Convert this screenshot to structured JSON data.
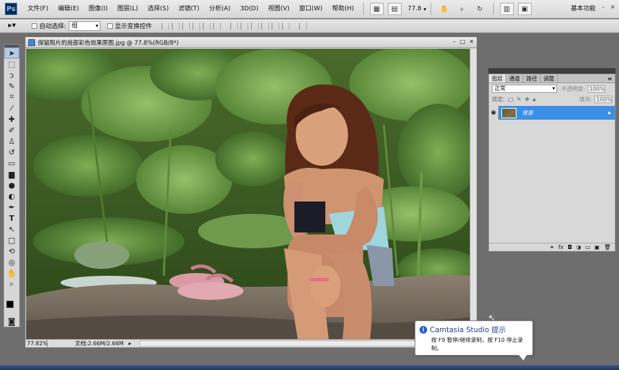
{
  "app": {
    "logo": "Ps"
  },
  "menu": [
    "文件(F)",
    "编辑(E)",
    "图像(I)",
    "图层(L)",
    "选择(S)",
    "滤镜(T)",
    "分析(A)",
    "3D(D)",
    "视图(V)",
    "窗口(W)",
    "帮助(H)"
  ],
  "menubar": {
    "zoom": "77.8",
    "workspace": "基本功能"
  },
  "options": {
    "auto_select_label": "自动选择:",
    "auto_select_value": "组",
    "show_transform_label": "显示变换控件"
  },
  "document": {
    "title": "保留照片的局部彩色效果原图.jpg @ 77.8%(RGB/8*)",
    "zoom": "77.82%",
    "doc_info": "文档:2.66M/2.66M"
  },
  "layers_panel": {
    "tabs": [
      "图层",
      "通道",
      "路径",
      "调整"
    ],
    "blend_mode": "正常",
    "opacity_label": "不透明度:",
    "opacity_value": "100%",
    "lock_label": "锁定:",
    "fill_label": "填充:",
    "fill_value": "100%",
    "layer_name": "背景"
  },
  "tooltip": {
    "title": "Camtasia Studio 提示",
    "body": "按 F9 暂停/继续录制，按 F10 停止录制。"
  }
}
